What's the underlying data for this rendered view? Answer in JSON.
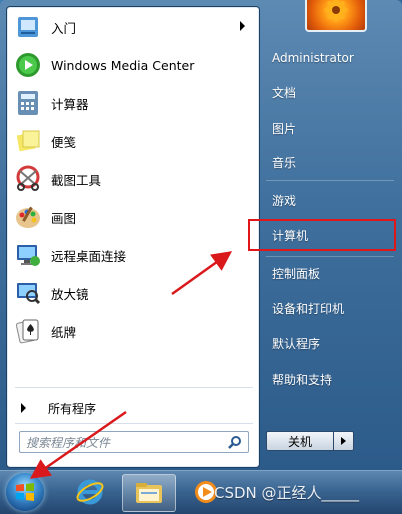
{
  "start_menu": {
    "programs": [
      {
        "label": "入门",
        "icon": "getting-started-icon",
        "has_submenu": true
      },
      {
        "label": "Windows Media Center",
        "icon": "media-center-icon",
        "has_submenu": false
      },
      {
        "label": "计算器",
        "icon": "calculator-icon",
        "has_submenu": false
      },
      {
        "label": "便笺",
        "icon": "sticky-notes-icon",
        "has_submenu": false
      },
      {
        "label": "截图工具",
        "icon": "snipping-tool-icon",
        "has_submenu": false
      },
      {
        "label": "画图",
        "icon": "paint-icon",
        "has_submenu": false
      },
      {
        "label": "远程桌面连接",
        "icon": "remote-desktop-icon",
        "has_submenu": false
      },
      {
        "label": "放大镜",
        "icon": "magnifier-icon",
        "has_submenu": false
      },
      {
        "label": "纸牌",
        "icon": "solitaire-icon",
        "has_submenu": false
      }
    ],
    "all_programs_label": "所有程序",
    "search_placeholder": "搜索程序和文件",
    "right_items": [
      "Administrator",
      "文档",
      "图片",
      "音乐",
      "游戏",
      "计算机",
      "控制面板",
      "设备和打印机",
      "默认程序",
      "帮助和支持"
    ],
    "highlighted_item": "计算机",
    "shutdown_label": "关机"
  },
  "taskbar": {
    "apps": [
      "start-orb-icon",
      "internet-explorer-icon",
      "windows-explorer-icon",
      "media-player-icon"
    ],
    "watermark": "CSDN @正经人_____"
  },
  "colors": {
    "highlight_box": "#e0161b",
    "annotation_arrow": "#d9191c"
  }
}
